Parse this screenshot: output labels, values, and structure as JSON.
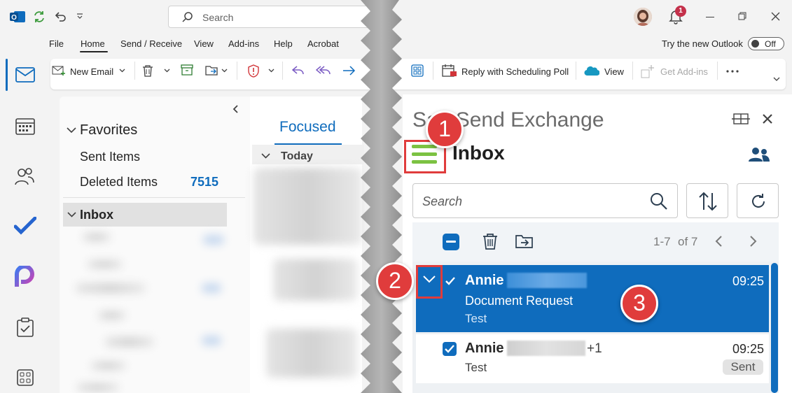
{
  "titlebar": {
    "search_placeholder": "Search",
    "notification_count": "1"
  },
  "menu": {
    "items": [
      "File",
      "Home",
      "Send / Receive",
      "View",
      "Add-ins",
      "Help",
      "Acrobat"
    ],
    "try_new_outlook": "Try the new Outlook",
    "toggle_state": "Off"
  },
  "ribbon": {
    "new_email": "New Email",
    "reply_poll": "Reply with Scheduling Poll",
    "view": "View",
    "get_addins": "Get Add-ins"
  },
  "folders": {
    "favorites": "Favorites",
    "sent_items": "Sent Items",
    "deleted_items": "Deleted Items",
    "deleted_count": "7515",
    "inbox": "Inbox"
  },
  "message_list": {
    "tab_focused": "Focused",
    "group_today": "Today"
  },
  "safesend": {
    "title": "SafeSend Exchange",
    "header": "Inbox",
    "search_placeholder": "Search",
    "pager": "1-7",
    "pager_of": "of 7",
    "items": [
      {
        "sender": "Annie",
        "time": "09:25",
        "subject": "Document Request",
        "preview": "Test"
      },
      {
        "sender": "Annie",
        "extra": "+1",
        "time": "09:25",
        "preview": "Test",
        "badge": "Sent"
      }
    ]
  },
  "callouts": [
    "1",
    "2",
    "3"
  ],
  "colors": {
    "accent": "#0f6cbd",
    "callout": "#e03c3c",
    "hamburger": "#7cc242"
  }
}
